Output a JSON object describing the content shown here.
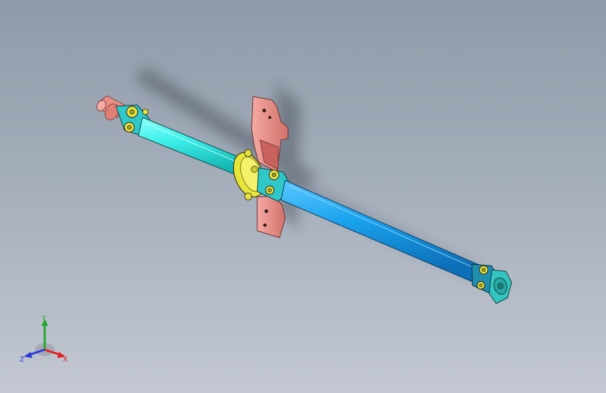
{
  "view": {
    "background_top": "#8f9aa8",
    "background_bottom": "#c3c8d2"
  },
  "model": {
    "front_shaft_color": "#3ef0ea",
    "rear_shaft_color": "#1aa3ee",
    "bracket_color": "#e98c86",
    "bearing_color": "#e8e53a",
    "yoke_color": "#30c7c9",
    "flange_color": "#33c4c0"
  },
  "triad": {
    "x_label": "X",
    "y_label": "Y",
    "z_label": "Z",
    "x_color": "#e02020",
    "y_color": "#1fa82a",
    "z_color": "#2a3ad8"
  }
}
